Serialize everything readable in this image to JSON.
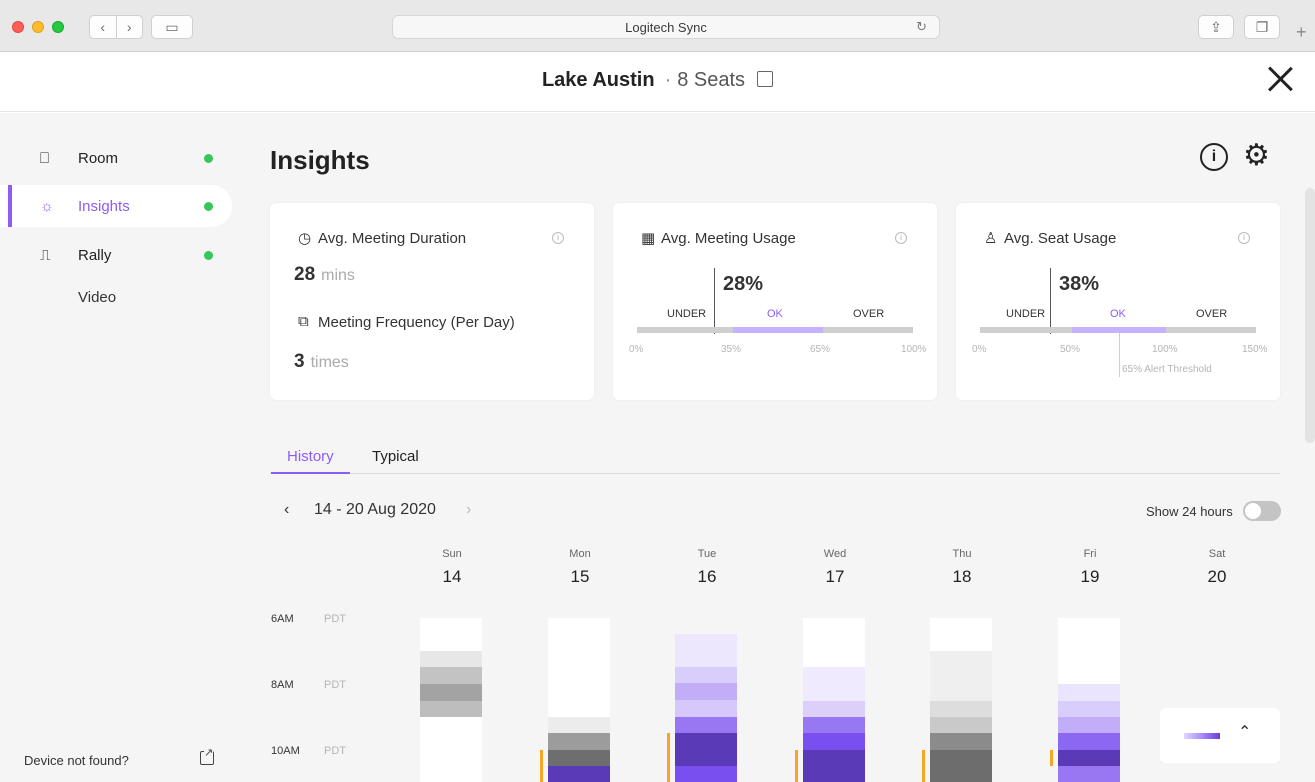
{
  "window": {
    "address_title": "Logitech Sync",
    "reload_icon": "↻",
    "nav_back": "‹",
    "nav_forward": "›",
    "sidebar_toggle": "▭",
    "share_icon": "⇪",
    "tabs_icon": "❐",
    "new_tab": "+"
  },
  "header": {
    "room_name": "Lake Austin",
    "separator": "·",
    "seats": "8 Seats"
  },
  "sidebar": {
    "items": [
      {
        "label": "Room",
        "icon": "⎕",
        "status": "online"
      },
      {
        "label": "Insights",
        "icon": "☼",
        "status": "online",
        "active": true
      },
      {
        "label": "Rally",
        "icon": "⎍",
        "status": "online"
      }
    ],
    "sub_items": [
      "Video"
    ],
    "footer_text": "Device not found?"
  },
  "main": {
    "title": "Insights",
    "info_label": "i",
    "gear_icon": "⚙"
  },
  "cards": {
    "duration": {
      "icon": "◷",
      "title": "Avg. Meeting Duration",
      "value": "28",
      "unit": "mins",
      "freq_icon": "⧉",
      "freq_title": "Meeting Frequency (Per Day)",
      "freq_value": "3",
      "freq_unit": "times"
    },
    "meeting_usage": {
      "icon": "▦",
      "title": "Avg. Meeting Usage",
      "value": "28%",
      "value_fraction": 0.28,
      "zones": [
        "UNDER",
        "OK",
        "OVER"
      ],
      "ticks": [
        "0%",
        "35%",
        "65%",
        "100%"
      ]
    },
    "seat_usage": {
      "icon": "♙",
      "title": "Avg. Seat Usage",
      "value": "38%",
      "value_fraction": 0.38,
      "zones": [
        "UNDER",
        "OK",
        "OVER"
      ],
      "ticks": [
        "0%",
        "50%",
        "100%",
        "150%"
      ],
      "alert": "65% Alert Threshold"
    },
    "info_glyph": "i"
  },
  "tabs": [
    "History",
    "Typical"
  ],
  "range": {
    "prev": "‹",
    "label": "14 - 20 Aug 2020",
    "next": "›",
    "toggle_label": "Show 24 hours",
    "toggle_on": false
  },
  "days": [
    {
      "name": "Sun",
      "num": "14"
    },
    {
      "name": "Mon",
      "num": "15"
    },
    {
      "name": "Tue",
      "num": "16"
    },
    {
      "name": "Wed",
      "num": "17"
    },
    {
      "name": "Thu",
      "num": "18"
    },
    {
      "name": "Fri",
      "num": "19"
    },
    {
      "name": "Sat",
      "num": "20"
    }
  ],
  "times": [
    {
      "label": "6AM",
      "tz": "PDT"
    },
    {
      "label": "8AM",
      "tz": "PDT"
    },
    {
      "label": "10AM",
      "tz": "PDT"
    }
  ],
  "colors": {
    "accent": "#8d5cf6",
    "status_online": "#36c75c",
    "occupancy_marker": "#f5a623"
  },
  "legend": {
    "chevron": "⌃"
  }
}
